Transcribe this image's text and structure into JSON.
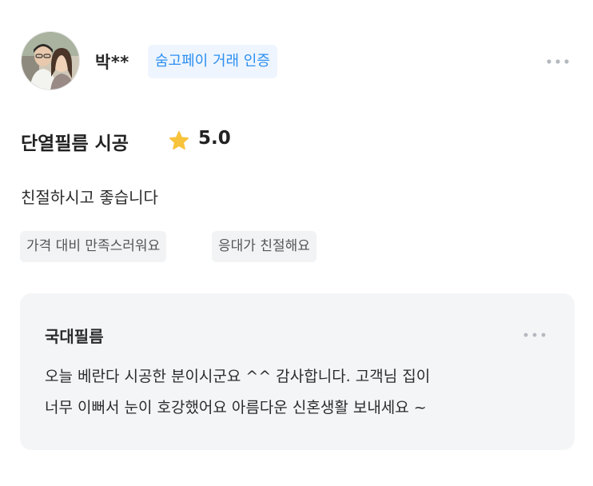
{
  "reviewer": {
    "name": "박**",
    "avatar_icon": "profile-photo",
    "badge": "숨고페이 거래 인증",
    "more_icon": "more-horizontal-icon"
  },
  "review": {
    "service": "단열필름 시공",
    "star_icon": "star-icon",
    "star_color": "#f7c33b",
    "rating": "5.0",
    "text": "친절하시고 좋습니다",
    "tags": [
      "가격 대비 만족스러워요",
      "응대가 친절해요"
    ]
  },
  "reply": {
    "author": "국대필름",
    "more_icon": "more-horizontal-icon",
    "lines": [
      "오늘 베란다 시공한 분이시군요 ^^ 감사합니다. 고객님 집이",
      "너무 이뻐서 눈이 호강했어요 아름다운 신혼생활 보내세요 ~"
    ]
  },
  "colors": {
    "badge_text": "#2d8ff1",
    "badge_bg": "#eef5fe",
    "reply_bg": "#f4f5f7",
    "tag_bg": "#f2f3f5"
  }
}
